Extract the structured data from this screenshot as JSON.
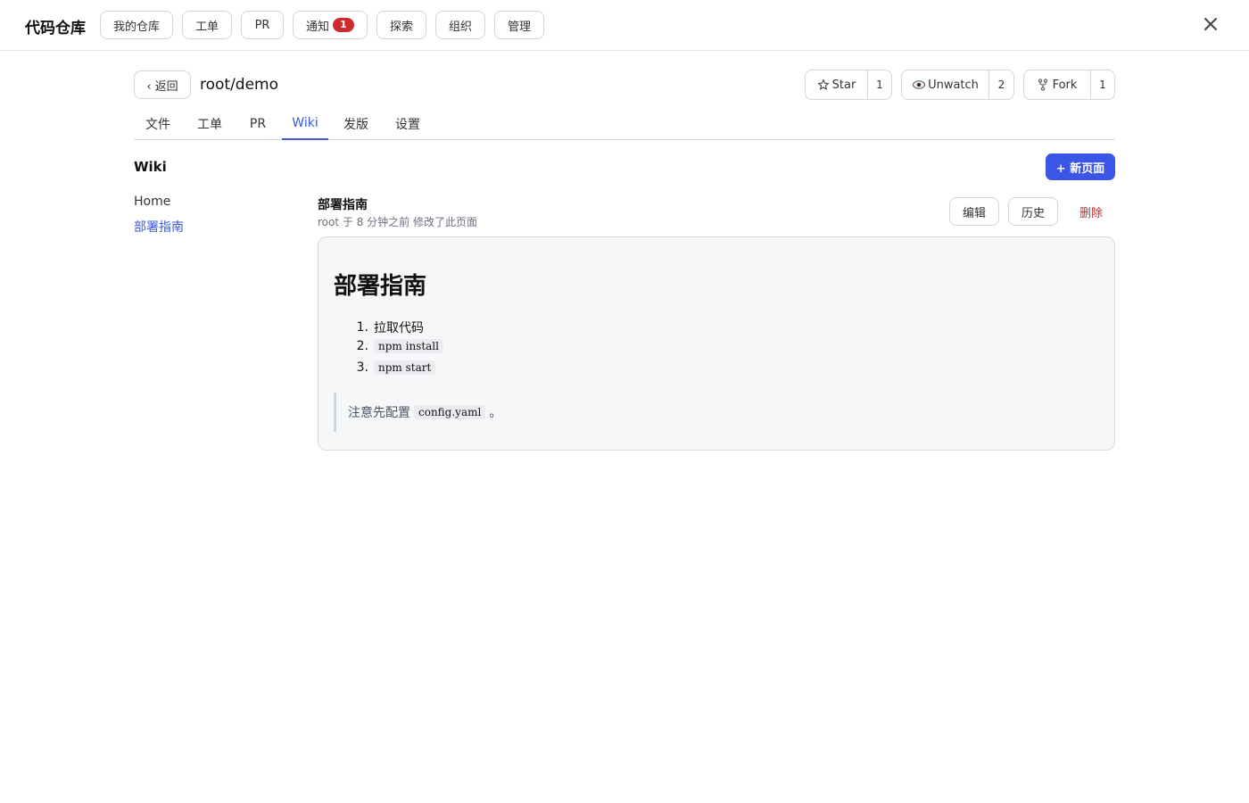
{
  "topbar": {
    "brand": "代码仓库",
    "nav": [
      "我的仓库",
      "工单",
      "PR",
      "通知",
      "探索",
      "组织",
      "管理"
    ],
    "notif_count": "1"
  },
  "repo": {
    "back_label": "‹ 返回",
    "name": "root/demo",
    "star": {
      "label": "Star",
      "count": "1"
    },
    "watch": {
      "label": "Unwatch",
      "count": "2"
    },
    "fork": {
      "label": "Fork",
      "count": "1"
    }
  },
  "tabs": [
    "文件",
    "工单",
    "PR",
    "Wiki",
    "发版",
    "设置"
  ],
  "active_tab": "Wiki",
  "wiki": {
    "title": "Wiki",
    "new_page": "+ 新页面",
    "pages": [
      "Home",
      "部署指南"
    ],
    "current_page": "部署指南"
  },
  "page": {
    "title": "部署指南",
    "meta": "root 于 8 分钟之前 修改了此页面",
    "edit": "编辑",
    "history": "历史",
    "delete": "删除",
    "heading": "部署指南",
    "steps": [
      {
        "num": "1.",
        "text": "拉取代码"
      },
      {
        "num": "2.",
        "code": "npm install"
      },
      {
        "num": "3.",
        "code": "npm start"
      }
    ],
    "note_prefix": "注意先配置",
    "note_code": "config.yaml",
    "note_suffix": "。"
  },
  "colors": {
    "accent": "#3b5bdb",
    "danger": "#cf2b2b",
    "primary_button": "#3b55e6"
  }
}
